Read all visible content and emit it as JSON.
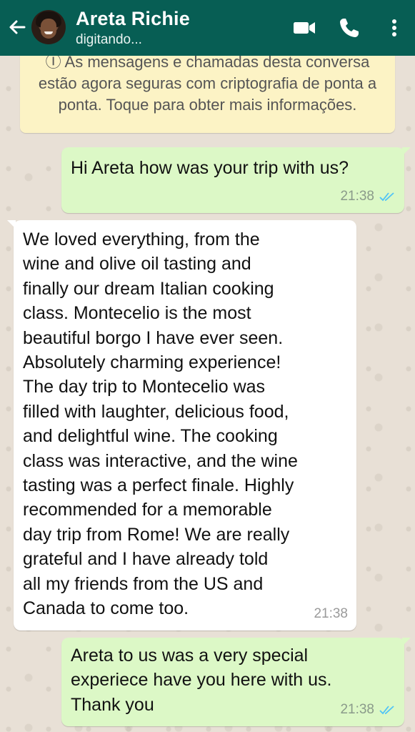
{
  "header": {
    "name": "Areta Richie",
    "status": "digitando..."
  },
  "encryption_notice": "Ⓘ As mensagens e chamadas desta conversa estão agora seguras com criptografia de ponta a ponta. Toque para obter mais informações.",
  "messages": [
    {
      "direction": "outgoing",
      "text": "Hi Areta how was your trip with us?",
      "time": "21:38",
      "read": true
    },
    {
      "direction": "incoming",
      "text": "We loved everything, from the\nwine and olive oil tasting and\nfinally our dream Italian cooking\nclass.  Montecelio is the most\nbeautiful borgo I have ever seen.\nAbsolutely charming experience!\nThe day trip to Montecelio was\nfilled with laughter, delicious food,\nand delightful wine.  The cooking\nclass was interactive, and the wine\ntasting was a perfect finale.  Highly\nrecommended for a memorable\nday trip from Rome!  We are really\ngrateful and I have already told\nall my friends from the US and\nCanada to come too.",
      "time": "21:38"
    },
    {
      "direction": "outgoing",
      "text": "Areta to us was a very special\nexperiece have you here with us.\nThank you",
      "time": "21:38",
      "read": true
    }
  ],
  "colors": {
    "header": "#075e54",
    "outgoing_bubble": "#dcf8c6",
    "incoming_bubble": "#ffffff",
    "notice_bubble": "#fcf3c5",
    "read_tick": "#4fc3f7"
  }
}
